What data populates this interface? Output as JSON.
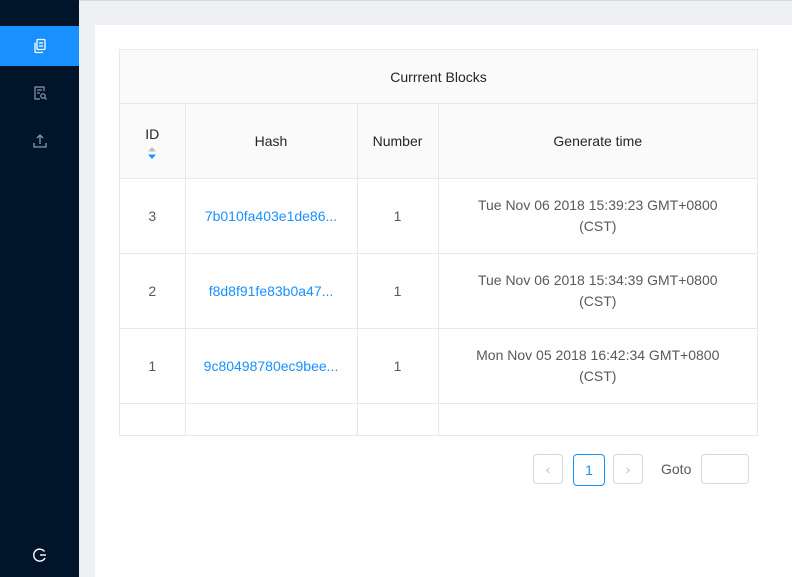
{
  "sidebar": {
    "items": [
      {
        "icon": "documents-icon",
        "active": true
      },
      {
        "icon": "search-document-icon",
        "active": false
      },
      {
        "icon": "upload-icon",
        "active": false
      }
    ],
    "bottom_icon": "logout-icon"
  },
  "table": {
    "title": "Currrent Blocks",
    "columns": [
      "ID",
      "Hash",
      "Number",
      "Generate time"
    ],
    "rows": [
      {
        "id": "3",
        "hash": "7b010fa403e1de86...",
        "number": "1",
        "time": "Tue Nov 06 2018 15:39:23 GMT+0800 (CST)"
      },
      {
        "id": "2",
        "hash": "f8d8f91fe83b0a47...",
        "number": "1",
        "time": "Tue Nov 06 2018 15:34:39 GMT+0800 (CST)"
      },
      {
        "id": "1",
        "hash": "9c80498780ec9bee...",
        "number": "1",
        "time": "Mon Nov 05 2018 16:42:34 GMT+0800 (CST)"
      }
    ]
  },
  "pagination": {
    "prev": "‹",
    "current_page": "1",
    "next": "›",
    "goto_label": "Goto",
    "goto_value": ""
  },
  "colors": {
    "sidebar_bg": "#001529",
    "accent": "#1890ff"
  }
}
